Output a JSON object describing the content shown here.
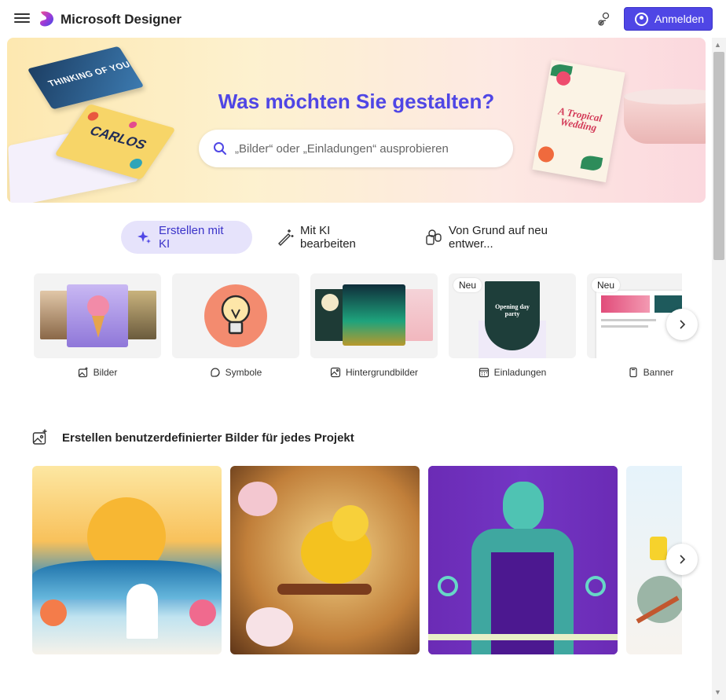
{
  "header": {
    "brand": "Microsoft Designer",
    "signin_label": "Anmelden"
  },
  "hero": {
    "title": "Was möchten Sie gestalten?",
    "search_placeholder": "„Bilder“ oder „Einladungen“ ausprobieren",
    "card_text_1": "THINKING OF YOU",
    "card_text_2": "CARLOS",
    "card_text_3": "A Tropical Wedding"
  },
  "tabs": [
    {
      "label": "Erstellen mit KI",
      "active": true
    },
    {
      "label": "Mit KI bearbeiten",
      "active": false
    },
    {
      "label": "Von Grund auf neu entwer...",
      "active": false
    }
  ],
  "categories": [
    {
      "label": "Bilder",
      "icon": "image-sparkle-icon",
      "badge": ""
    },
    {
      "label": "Symbole",
      "icon": "sticker-icon",
      "badge": ""
    },
    {
      "label": "Hintergrundbilder",
      "icon": "wallpaper-icon",
      "badge": ""
    },
    {
      "label": "Einladungen",
      "icon": "calendar-icon",
      "badge": "Neu",
      "card_text": "Opening day party"
    },
    {
      "label": "Banner",
      "icon": "banner-icon",
      "badge": "Neu"
    }
  ],
  "section": {
    "title": "Erstellen benutzerdefinierter Bilder für jedes Projekt"
  },
  "colors": {
    "accent": "#4f46e5",
    "tab_active_bg": "#e6e3fb"
  }
}
